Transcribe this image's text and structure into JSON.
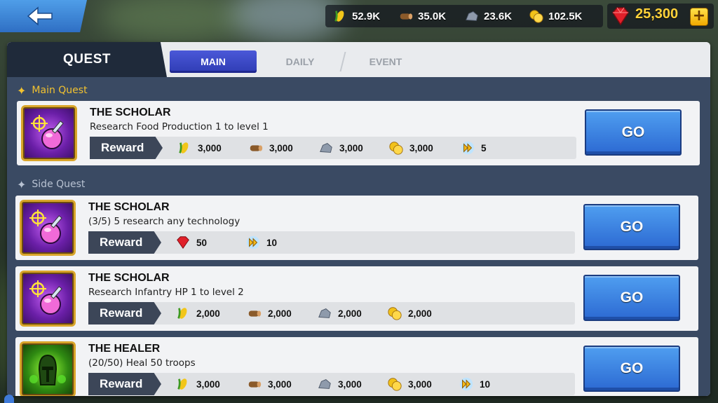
{
  "resources": {
    "food": "52.9K",
    "wood": "35.0K",
    "stone": "23.6K",
    "gold": "102.5K",
    "gems": "25,300"
  },
  "panel": {
    "title": "QUEST",
    "tabs": [
      {
        "label": "MAIN",
        "active": true
      },
      {
        "label": "DAILY",
        "active": false
      },
      {
        "label": "EVENT",
        "active": false
      }
    ]
  },
  "sections": {
    "main_title": "Main Quest",
    "side_title": "Side Quest"
  },
  "quests": [
    {
      "title": "THE SCHOLAR",
      "desc": "Research Food Production 1 to level 1",
      "reward_label": "Reward",
      "rewards": [
        {
          "icon": "food-icon",
          "value": "3,000"
        },
        {
          "icon": "wood-icon",
          "value": "3,000"
        },
        {
          "icon": "stone-icon",
          "value": "3,000"
        },
        {
          "icon": "gold-icon",
          "value": "3,000"
        },
        {
          "icon": "speedup-icon",
          "value": "5"
        }
      ],
      "go": "GO"
    },
    {
      "title": "THE SCHOLAR",
      "desc": "(3/5) 5 research any technology",
      "reward_label": "Reward",
      "rewards": [
        {
          "icon": "gem-icon",
          "value": "50"
        },
        {
          "icon": "speedup-icon",
          "value": "10"
        }
      ],
      "go": "GO"
    },
    {
      "title": "THE SCHOLAR",
      "desc": "Research Infantry HP 1 to level 2",
      "reward_label": "Reward",
      "rewards": [
        {
          "icon": "food-icon",
          "value": "2,000"
        },
        {
          "icon": "wood-icon",
          "value": "2,000"
        },
        {
          "icon": "stone-icon",
          "value": "2,000"
        },
        {
          "icon": "gold-icon",
          "value": "2,000"
        }
      ],
      "go": "GO"
    },
    {
      "title": "THE HEALER",
      "desc": "(20/50) Heal 50 troops",
      "reward_label": "Reward",
      "rewards": [
        {
          "icon": "food-icon",
          "value": "3,000"
        },
        {
          "icon": "wood-icon",
          "value": "3,000"
        },
        {
          "icon": "stone-icon",
          "value": "3,000"
        },
        {
          "icon": "gold-icon",
          "value": "3,000"
        },
        {
          "icon": "speedup-icon",
          "value": "10"
        }
      ],
      "go": "GO"
    }
  ],
  "colors": {
    "accent_gold": "#ffd23a",
    "main_quest": "#f2c230",
    "side_quest": "#b8c2d2",
    "go_button": "#2c69d2"
  }
}
